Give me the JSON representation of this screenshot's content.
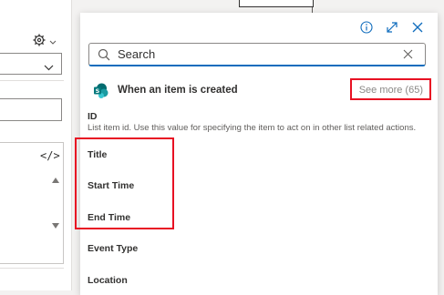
{
  "popup": {
    "search_placeholder": "Search",
    "trigger_label": "When an item is created",
    "see_more": "See more (65)",
    "items": [
      {
        "label": "ID",
        "description": "List item id. Use this value for specifying the item to act on in other list related actions."
      },
      {
        "label": "Title"
      },
      {
        "label": "Start Time"
      },
      {
        "label": "End Time"
      },
      {
        "label": "Event Type"
      },
      {
        "label": "Location"
      }
    ]
  },
  "icons": {
    "info": "info-icon",
    "expand": "expand-icon",
    "close": "close-icon",
    "search": "search-icon",
    "clear": "clear-icon",
    "sharepoint": "sharepoint-icon",
    "settings": "gear-icon",
    "code": "code-icon"
  },
  "left_panel": {
    "code_glyph": "</>"
  },
  "colors": {
    "accent": "#0f6cbd",
    "annotation": "#e81123",
    "sharepoint_teal": "#03787c"
  }
}
